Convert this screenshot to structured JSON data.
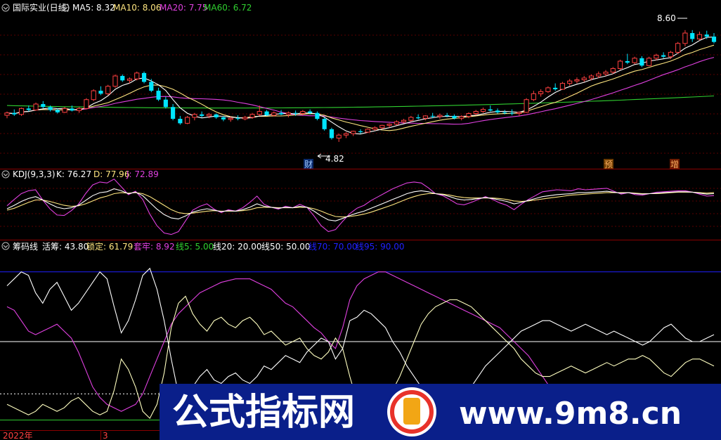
{
  "colors": {
    "up": "#ff4040",
    "down": "#00e5ff",
    "ma5": "#ffffff",
    "ma10": "#ffe680",
    "ma20": "#e040e0",
    "ma60": "#30d030",
    "k": "#ffffff",
    "d": "#ffe680",
    "j": "#e040e0",
    "huochou": "#ffffff",
    "suoding": "#ffffc0",
    "taolao": "#e040e0",
    "line5": "#30d030",
    "line20": "#ffffff",
    "line50": "#ffffff",
    "line70": "#2020ff",
    "line95": "#2020ff",
    "grid": "#5a0000",
    "separator": "#8b0000"
  },
  "price_panel": {
    "title": "国际实业(日线)",
    "legend": [
      {
        "key": "ma5",
        "text": "MA5: 8.32"
      },
      {
        "key": "ma10",
        "text": "MA10: 8.06"
      },
      {
        "key": "ma20",
        "text": "MA20: 7.75"
      },
      {
        "key": "ma60",
        "text": "MA60: 6.72"
      }
    ],
    "high_label": "8.60",
    "low_label": "4.82",
    "events": [
      "财",
      "预",
      "增"
    ]
  },
  "kdj_panel": {
    "legend": [
      {
        "key": "d",
        "text": "KDJ(9,3,3)"
      },
      {
        "key": "k",
        "text": "K: 76.27"
      },
      {
        "key": "d",
        "text": "D: 77.96"
      },
      {
        "key": "j",
        "text": "J: 72.89"
      }
    ]
  },
  "chip_panel": {
    "legend": [
      {
        "key": "k",
        "text": "筹码线"
      },
      {
        "key": "k",
        "text": "活筹: 43.80"
      },
      {
        "key": "d",
        "text": "锁定: 61.79"
      },
      {
        "key": "j",
        "text": "套牢: 8.92"
      },
      {
        "key": "line5",
        "text": "线5: 5.00"
      },
      {
        "key": "k",
        "text": "线20: 20.00"
      },
      {
        "key": "k",
        "text": "线50: 50.00"
      },
      {
        "key": "line70",
        "text": "线70: 70.00"
      },
      {
        "key": "line70",
        "text": "线95: 90.00"
      }
    ]
  },
  "x_axis": {
    "labels": [
      "2022年",
      "3"
    ]
  },
  "watermark": {
    "left_text": "公式指标网",
    "right_text": "www.9m8.cn"
  },
  "chart_data": {
    "type": "candlestick",
    "price": {
      "ylim": [
        4.2,
        9.0
      ],
      "candles": [
        [
          5.72,
          5.85,
          5.62,
          5.8
        ],
        [
          5.8,
          5.92,
          5.7,
          5.75
        ],
        [
          5.75,
          5.98,
          5.7,
          5.95
        ],
        [
          5.95,
          6.05,
          5.85,
          5.9
        ],
        [
          5.9,
          6.15,
          5.88,
          6.1
        ],
        [
          6.1,
          6.2,
          5.95,
          6.0
        ],
        [
          6.0,
          6.05,
          5.85,
          5.9
        ],
        [
          5.9,
          5.95,
          5.78,
          5.82
        ],
        [
          5.82,
          6.0,
          5.8,
          5.95
        ],
        [
          5.95,
          6.05,
          5.85,
          5.88
        ],
        [
          5.88,
          6.0,
          5.8,
          5.95
        ],
        [
          5.95,
          6.3,
          5.92,
          6.25
        ],
        [
          6.25,
          6.6,
          6.2,
          6.55
        ],
        [
          6.55,
          6.7,
          6.4,
          6.45
        ],
        [
          6.45,
          6.75,
          6.4,
          6.7
        ],
        [
          6.7,
          7.1,
          6.65,
          7.05
        ],
        [
          7.05,
          7.1,
          6.85,
          6.9
        ],
        [
          6.9,
          7.0,
          6.8,
          6.95
        ],
        [
          6.95,
          7.2,
          6.9,
          7.15
        ],
        [
          7.15,
          7.2,
          6.8,
          6.85
        ],
        [
          6.85,
          6.95,
          6.5,
          6.55
        ],
        [
          6.55,
          6.65,
          6.2,
          6.25
        ],
        [
          6.25,
          6.35,
          5.95,
          6.0
        ],
        [
          6.0,
          6.1,
          5.55,
          5.6
        ],
        [
          5.6,
          5.7,
          5.4,
          5.45
        ],
        [
          5.45,
          5.7,
          5.42,
          5.65
        ],
        [
          5.65,
          5.8,
          5.55,
          5.75
        ],
        [
          5.75,
          5.85,
          5.65,
          5.7
        ],
        [
          5.7,
          5.8,
          5.62,
          5.75
        ],
        [
          5.75,
          5.78,
          5.6,
          5.65
        ],
        [
          5.65,
          5.7,
          5.52,
          5.58
        ],
        [
          5.58,
          5.68,
          5.5,
          5.62
        ],
        [
          5.62,
          5.72,
          5.55,
          5.6
        ],
        [
          5.6,
          5.7,
          5.55,
          5.65
        ],
        [
          5.65,
          5.8,
          5.6,
          5.75
        ],
        [
          5.75,
          6.05,
          5.7,
          5.85
        ],
        [
          5.85,
          5.9,
          5.7,
          5.72
        ],
        [
          5.72,
          5.85,
          5.68,
          5.8
        ],
        [
          5.8,
          5.9,
          5.72,
          5.75
        ],
        [
          5.75,
          5.85,
          5.65,
          5.8
        ],
        [
          5.8,
          5.88,
          5.7,
          5.78
        ],
        [
          5.78,
          5.9,
          5.72,
          5.85
        ],
        [
          5.85,
          5.92,
          5.75,
          5.8
        ],
        [
          5.8,
          5.85,
          5.55,
          5.6
        ],
        [
          5.6,
          5.65,
          5.2,
          5.25
        ],
        [
          5.25,
          5.3,
          4.9,
          4.95
        ],
        [
          4.95,
          5.1,
          4.82,
          5.05
        ],
        [
          5.05,
          5.15,
          4.95,
          5.1
        ],
        [
          5.1,
          5.2,
          5.02,
          5.18
        ],
        [
          5.18,
          5.25,
          5.1,
          5.15
        ],
        [
          5.15,
          5.28,
          5.12,
          5.25
        ],
        [
          5.25,
          5.35,
          5.2,
          5.3
        ],
        [
          5.3,
          5.4,
          5.25,
          5.38
        ],
        [
          5.38,
          5.45,
          5.3,
          5.42
        ],
        [
          5.42,
          5.55,
          5.38,
          5.5
        ],
        [
          5.5,
          5.6,
          5.45,
          5.55
        ],
        [
          5.55,
          5.7,
          5.5,
          5.65
        ],
        [
          5.65,
          5.75,
          5.58,
          5.62
        ],
        [
          5.62,
          5.72,
          5.55,
          5.7
        ],
        [
          5.7,
          5.8,
          5.62,
          5.68
        ],
        [
          5.68,
          5.78,
          5.6,
          5.72
        ],
        [
          5.72,
          5.8,
          5.65,
          5.7
        ],
        [
          5.7,
          5.75,
          5.58,
          5.62
        ],
        [
          5.62,
          5.72,
          5.55,
          5.68
        ],
        [
          5.68,
          5.82,
          5.62,
          5.78
        ],
        [
          5.78,
          5.9,
          5.72,
          5.85
        ],
        [
          5.85,
          5.98,
          5.8,
          5.92
        ],
        [
          5.92,
          6.05,
          5.85,
          5.88
        ],
        [
          5.88,
          5.95,
          5.78,
          5.82
        ],
        [
          5.82,
          5.9,
          5.75,
          5.8
        ],
        [
          5.8,
          5.92,
          5.72,
          5.78
        ],
        [
          5.78,
          5.85,
          5.7,
          5.82
        ],
        [
          5.82,
          6.3,
          5.8,
          6.25
        ],
        [
          6.25,
          6.55,
          6.2,
          6.45
        ],
        [
          6.45,
          6.6,
          6.35,
          6.52
        ],
        [
          6.52,
          6.7,
          6.48,
          6.65
        ],
        [
          6.65,
          6.8,
          6.55,
          6.6
        ],
        [
          6.6,
          6.85,
          6.58,
          6.8
        ],
        [
          6.8,
          6.95,
          6.72,
          6.88
        ],
        [
          6.88,
          7.0,
          6.8,
          6.92
        ],
        [
          6.92,
          7.05,
          6.85,
          6.98
        ],
        [
          6.98,
          7.1,
          6.9,
          7.05
        ],
        [
          7.05,
          7.2,
          6.98,
          7.12
        ],
        [
          7.12,
          7.25,
          7.05,
          7.18
        ],
        [
          7.18,
          7.35,
          7.12,
          7.3
        ],
        [
          7.3,
          7.6,
          7.25,
          7.55
        ],
        [
          7.55,
          7.8,
          7.45,
          7.5
        ],
        [
          7.5,
          7.7,
          7.45,
          7.65
        ],
        [
          7.65,
          7.72,
          7.35,
          7.4
        ],
        [
          7.4,
          7.7,
          7.38,
          7.65
        ],
        [
          7.65,
          7.8,
          7.58,
          7.75
        ],
        [
          7.75,
          7.85,
          7.65,
          7.7
        ],
        [
          7.7,
          7.9,
          7.62,
          7.85
        ],
        [
          7.85,
          8.2,
          7.8,
          8.15
        ],
        [
          8.15,
          8.6,
          8.05,
          8.5
        ],
        [
          8.5,
          8.6,
          8.2,
          8.3
        ],
        [
          8.3,
          8.55,
          8.25,
          8.45
        ],
        [
          8.45,
          8.58,
          8.3,
          8.38
        ],
        [
          8.38,
          8.5,
          8.15,
          8.2
        ]
      ]
    },
    "kdj": {
      "ylim": [
        -10,
        110
      ],
      "k": [
        45,
        52,
        60,
        66,
        70,
        63,
        55,
        48,
        45,
        47,
        52,
        62,
        72,
        78,
        80,
        86,
        82,
        76,
        79,
        72,
        58,
        44,
        33,
        26,
        24,
        30,
        38,
        42,
        45,
        42,
        39,
        41,
        40,
        43,
        48,
        55,
        50,
        48,
        46,
        48,
        47,
        50,
        48,
        40,
        30,
        22,
        20,
        25,
        31,
        36,
        40,
        46,
        52,
        58,
        64,
        70,
        76,
        80,
        82,
        80,
        76,
        74,
        70,
        65,
        63,
        64,
        66,
        68,
        66,
        63,
        60,
        55,
        58,
        62,
        66,
        70,
        72,
        74,
        75,
        76,
        78,
        78,
        79,
        80,
        81,
        79,
        77,
        78,
        76,
        75,
        76,
        77,
        78,
        79,
        80,
        80,
        79,
        77,
        75,
        76
      ],
      "d": [
        42,
        46,
        52,
        58,
        63,
        63,
        60,
        56,
        52,
        50,
        51,
        55,
        61,
        67,
        71,
        76,
        78,
        77,
        78,
        76,
        70,
        61,
        52,
        43,
        37,
        35,
        36,
        38,
        40,
        41,
        40,
        40,
        40,
        41,
        43,
        47,
        48,
        48,
        47,
        47,
        47,
        48,
        48,
        45,
        40,
        34,
        29,
        28,
        29,
        31,
        34,
        38,
        43,
        48,
        53,
        59,
        65,
        70,
        74,
        76,
        76,
        75,
        73,
        70,
        68,
        67,
        67,
        67,
        67,
        66,
        64,
        61,
        60,
        61,
        63,
        65,
        67,
        69,
        71,
        73,
        74,
        75,
        76,
        77,
        78,
        78,
        78,
        78,
        77,
        76,
        76,
        76,
        77,
        78,
        79,
        79,
        79,
        78,
        77,
        78
      ],
      "j": [
        51,
        64,
        76,
        82,
        84,
        63,
        45,
        32,
        31,
        41,
        54,
        76,
        94,
        100,
        98,
        106,
        90,
        74,
        81,
        64,
        34,
        10,
        -5,
        -8,
        -2,
        20,
        42,
        50,
        55,
        44,
        37,
        43,
        40,
        47,
        58,
        71,
        54,
        48,
        44,
        50,
        47,
        54,
        48,
        30,
        10,
        -2,
        2,
        19,
        35,
        46,
        52,
        62,
        70,
        78,
        86,
        92,
        98,
        100,
        98,
        88,
        76,
        72,
        64,
        55,
        53,
        58,
        64,
        70,
        64,
        57,
        52,
        43,
        54,
        64,
        72,
        80,
        82,
        84,
        83,
        82,
        86,
        84,
        85,
        86,
        87,
        81,
        75,
        78,
        74,
        73,
        76,
        79,
        80,
        81,
        82,
        82,
        79,
        75,
        71,
        72
      ]
    },
    "chip": {
      "ylim": [
        0,
        100
      ],
      "huochou": [
        82,
        86,
        90,
        88,
        78,
        72,
        80,
        84,
        76,
        68,
        72,
        78,
        84,
        90,
        86,
        70,
        55,
        62,
        74,
        88,
        92,
        80,
        62,
        40,
        20,
        16,
        24,
        30,
        34,
        28,
        26,
        30,
        32,
        28,
        26,
        30,
        36,
        34,
        38,
        42,
        40,
        38,
        44,
        48,
        52,
        50,
        40,
        46,
        62,
        64,
        68,
        66,
        62,
        58,
        50,
        44,
        36,
        30,
        24,
        20,
        18,
        16,
        16,
        18,
        20,
        24,
        30,
        36,
        40,
        44,
        48,
        52,
        56,
        58,
        60,
        62,
        62,
        60,
        58,
        56,
        58,
        60,
        58,
        56,
        54,
        56,
        54,
        52,
        50,
        48,
        50,
        54,
        58,
        60,
        56,
        52,
        50,
        50,
        52,
        54
      ],
      "suoding": [
        14,
        12,
        10,
        8,
        10,
        14,
        12,
        10,
        12,
        16,
        18,
        14,
        10,
        8,
        10,
        22,
        40,
        34,
        24,
        10,
        6,
        14,
        32,
        58,
        72,
        76,
        66,
        60,
        56,
        62,
        64,
        60,
        58,
        62,
        64,
        60,
        54,
        56,
        52,
        48,
        50,
        52,
        46,
        42,
        40,
        44,
        52,
        46,
        30,
        16,
        12,
        10,
        12,
        16,
        22,
        30,
        40,
        50,
        60,
        66,
        70,
        72,
        74,
        74,
        72,
        70,
        66,
        62,
        58,
        54,
        50,
        46,
        40,
        36,
        32,
        30,
        30,
        32,
        34,
        36,
        34,
        32,
        34,
        36,
        38,
        36,
        38,
        40,
        40,
        42,
        40,
        36,
        32,
        30,
        34,
        38,
        40,
        40,
        38,
        36
      ],
      "taolao": [
        70,
        68,
        62,
        56,
        54,
        56,
        58,
        60,
        56,
        52,
        44,
        34,
        24,
        18,
        14,
        12,
        10,
        12,
        14,
        20,
        30,
        40,
        50,
        60,
        66,
        70,
        74,
        78,
        80,
        82,
        84,
        85,
        86,
        86,
        86,
        84,
        82,
        80,
        76,
        72,
        70,
        66,
        62,
        58,
        55,
        50,
        46,
        58,
        74,
        82,
        86,
        88,
        90,
        90,
        88,
        86,
        84,
        82,
        80,
        78,
        76,
        74,
        72,
        70,
        68,
        66,
        64,
        62,
        60,
        58,
        54,
        50,
        46,
        42,
        36,
        30,
        24,
        20,
        18,
        16,
        14,
        14,
        14,
        14,
        14,
        14,
        13,
        12,
        12,
        11,
        11,
        10,
        10,
        10,
        9,
        9,
        9,
        9,
        9,
        9
      ],
      "line5": 5,
      "line20": 20,
      "line50": 50,
      "line70": 70,
      "line95": 90
    }
  }
}
